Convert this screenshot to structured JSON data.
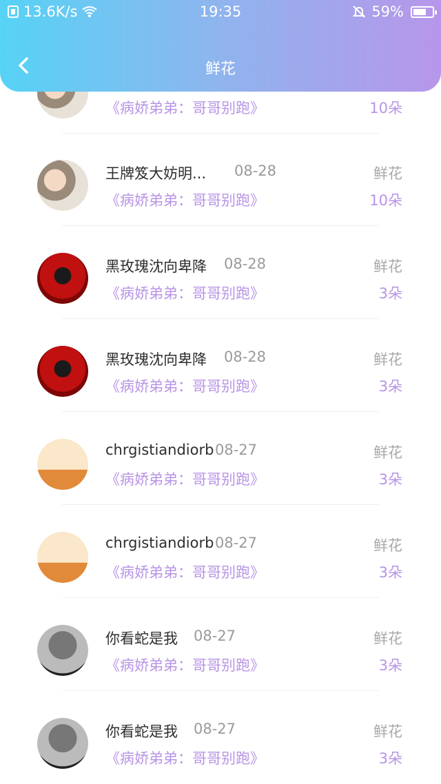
{
  "status_bar": {
    "net_speed": "13.6K/s",
    "time": "19:35",
    "battery": "59%"
  },
  "header": {
    "title": "鲜花"
  },
  "rows": [
    {
      "name": "",
      "date": "",
      "book": "《病娇弟弟：哥哥别跑》",
      "gift": "",
      "count": "10朵",
      "avatar": "photo"
    },
    {
      "name": "王牌笈大妨明...",
      "date": "08-28",
      "book": "《病娇弟弟：哥哥别跑》",
      "gift": "鲜花",
      "count": "10朵",
      "avatar": "photo"
    },
    {
      "name": "黑玫瑰沈向卑降",
      "date": "08-28",
      "book": "《病娇弟弟：哥哥别跑》",
      "gift": "鲜花",
      "count": "3朵",
      "avatar": "rose"
    },
    {
      "name": "黑玫瑰沈向卑降",
      "date": "08-28",
      "book": "《病娇弟弟：哥哥别跑》",
      "gift": "鲜花",
      "count": "3朵",
      "avatar": "rose"
    },
    {
      "name": "chrgistiandiorb",
      "date": "08-27",
      "book": "《病娇弟弟：哥哥别跑》",
      "gift": "鲜花",
      "count": "3朵",
      "avatar": "girl"
    },
    {
      "name": "chrgistiandiorb",
      "date": "08-27",
      "book": "《病娇弟弟：哥哥别跑》",
      "gift": "鲜花",
      "count": "3朵",
      "avatar": "girl"
    },
    {
      "name": "你看蛇是我",
      "date": "08-27",
      "book": "《病娇弟弟：哥哥别跑》",
      "gift": "鲜花",
      "count": "3朵",
      "avatar": "bw"
    },
    {
      "name": "你看蛇是我",
      "date": "08-27",
      "book": "《病娇弟弟：哥哥别跑》",
      "gift": "鲜花",
      "count": "3朵",
      "avatar": "bw"
    }
  ]
}
